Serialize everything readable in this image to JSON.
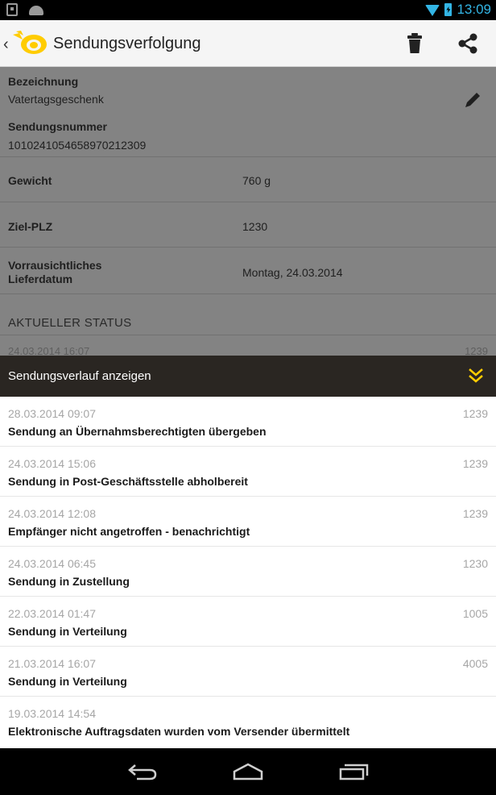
{
  "statusbar": {
    "time": "13:09"
  },
  "actionbar": {
    "title": "Sendungsverfolgung",
    "back_icon": "back-caret-icon",
    "logo_icon": "post-horn-logo",
    "delete_icon": "trash-icon",
    "share_icon": "share-icon"
  },
  "details": {
    "bezeichnung_label": "Bezeichnung",
    "bezeichnung_value": "Vatertagsgeschenk",
    "sendungsnummer_label": "Sendungsnummer",
    "sendungsnummer_value": "1010241054658970212309",
    "gewicht_label": "Gewicht",
    "gewicht_value": "760 g",
    "zielplz_label": "Ziel-PLZ",
    "zielplz_value": "1230",
    "lieferdatum_label_1": "Vorrausichtliches",
    "lieferdatum_label_2": "Lieferdatum",
    "lieferdatum_value": "Montag, 24.03.2014",
    "status_header": "AKTUELLER STATUS",
    "status_date_partial": "24.03.2014 16:07",
    "status_code_partial": "1239"
  },
  "historybar": {
    "label": "Sendungsverlauf anzeigen"
  },
  "history": [
    {
      "date": "28.03.2014 09:07",
      "code": "1239",
      "status": "Sendung an Übernahmsberechtigten übergeben"
    },
    {
      "date": "24.03.2014 15:06",
      "code": "1239",
      "status": "Sendung in Post-Geschäftsstelle abholbereit"
    },
    {
      "date": "24.03.2014 12:08",
      "code": "1239",
      "status": "Empfänger nicht angetroffen - benachrichtigt"
    },
    {
      "date": "24.03.2014 06:45",
      "code": "1230",
      "status": "Sendung in Zustellung"
    },
    {
      "date": "22.03.2014 01:47",
      "code": "1005",
      "status": "Sendung in Verteilung"
    },
    {
      "date": "21.03.2014 16:07",
      "code": "4005",
      "status": "Sendung in Verteilung"
    },
    {
      "date": "19.03.2014 14:54",
      "code": "",
      "status": "Elektronische Auftragsdaten wurden vom Versender übermittelt"
    }
  ],
  "colors": {
    "accent": "#ffcc00",
    "statusbar_accent": "#33b5e5",
    "history_bar": "#2a2622"
  }
}
